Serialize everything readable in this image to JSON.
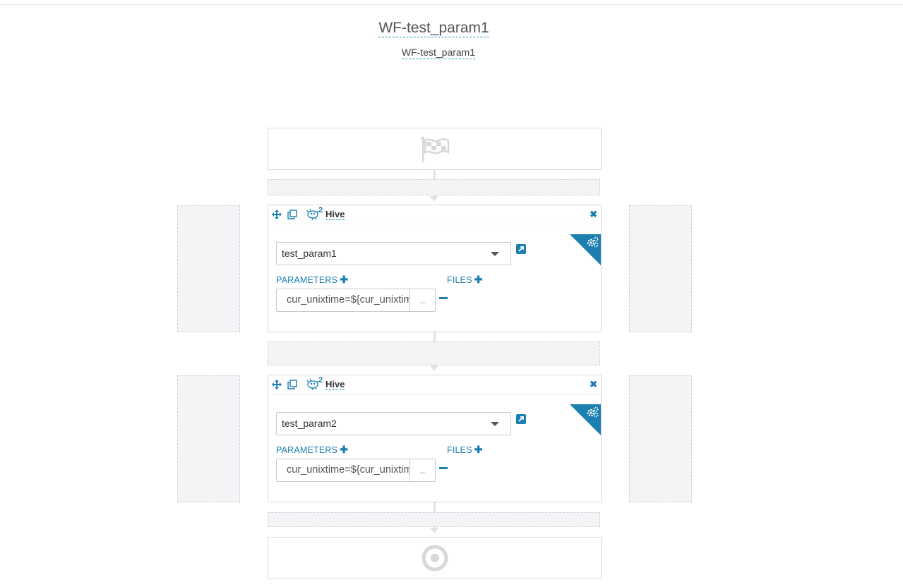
{
  "workflow": {
    "title": "WF-test_param1",
    "subtitle": "WF-test_param1"
  },
  "actions": [
    {
      "type_label": "Hive",
      "type_superscript": "2",
      "script": "test_param1",
      "parameters_label": "PARAMETERS",
      "files_label": "FILES",
      "parameter_value": "cur_unixtime=${cur_unixtime}",
      "param_button": ".."
    },
    {
      "type_label": "Hive",
      "type_superscript": "2",
      "script": "test_param2",
      "parameters_label": "PARAMETERS",
      "files_label": "FILES",
      "parameter_value": "cur_unixtime=${cur_unixtime}",
      "param_button": ".."
    }
  ],
  "icons": {
    "start": "flag-icon",
    "end": "target-icon",
    "move": "move-icon",
    "copy": "copy-icon",
    "hive": "hive-icon",
    "close": "close-icon",
    "settings": "gears-icon",
    "open": "external-link-icon",
    "add": "plus-icon",
    "remove": "minus-icon"
  },
  "colors": {
    "accent": "#1b7fb0",
    "drop_zone": "#f3f4f6",
    "border": "#d9d9d9"
  }
}
